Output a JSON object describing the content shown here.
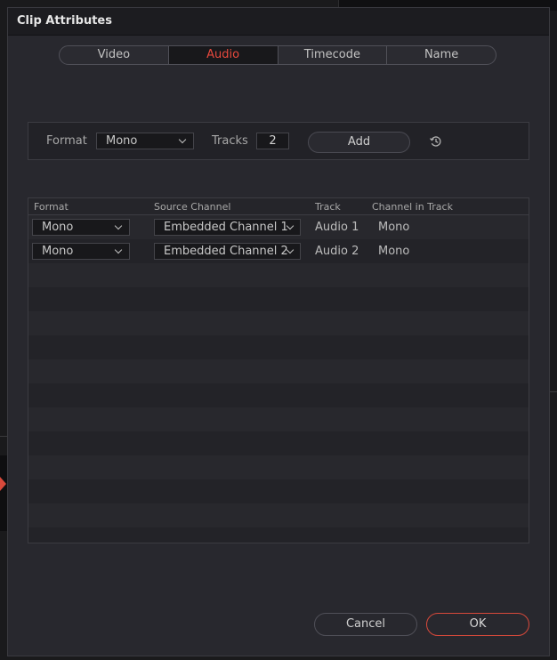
{
  "dialog": {
    "title": "Clip Attributes"
  },
  "tabs": [
    {
      "label": "Video",
      "active": false
    },
    {
      "label": "Audio",
      "active": true
    },
    {
      "label": "Timecode",
      "active": false
    },
    {
      "label": "Name",
      "active": false
    }
  ],
  "format_panel": {
    "format_label": "Format",
    "format_value": "Mono",
    "tracks_label": "Tracks",
    "tracks_value": "2",
    "add_label": "Add",
    "reset_icon": "reset-history-icon"
  },
  "table": {
    "headers": {
      "format": "Format",
      "source_channel": "Source Channel",
      "track": "Track",
      "channel_in_track": "Channel in Track"
    },
    "rows": [
      {
        "format": "Mono",
        "source_channel": "Embedded Channel 1",
        "track": "Audio 1",
        "channel_in_track": "Mono"
      },
      {
        "format": "Mono",
        "source_channel": "Embedded Channel 2",
        "track": "Audio 2",
        "channel_in_track": "Mono"
      }
    ]
  },
  "footer": {
    "cancel_label": "Cancel",
    "ok_label": "OK"
  },
  "colors": {
    "accent": "#e8493d",
    "background": "#28282e"
  }
}
